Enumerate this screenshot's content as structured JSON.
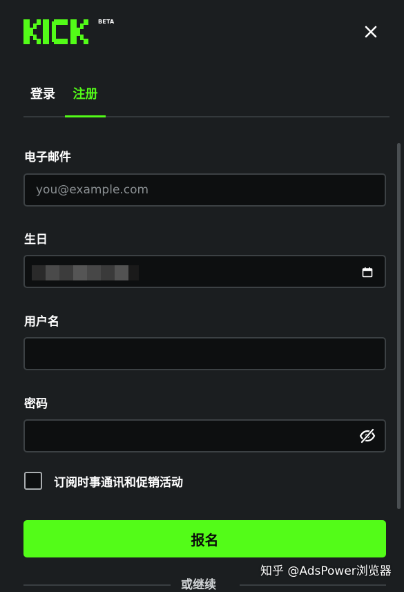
{
  "header": {
    "logo_text": "KICK",
    "badge": "BETA",
    "brand_color": "#53fc18",
    "close_icon": "close-icon"
  },
  "tabs": [
    {
      "label": "登录",
      "active": false
    },
    {
      "label": "注册",
      "active": true
    }
  ],
  "form": {
    "email": {
      "label": "电子邮件",
      "placeholder": "you@example.com",
      "value": ""
    },
    "birthday": {
      "label": "生日",
      "value_obscured": true,
      "icon": "calendar-icon"
    },
    "username": {
      "label": "用户名",
      "value": ""
    },
    "password": {
      "label": "密码",
      "value": "",
      "icon": "eye-off-icon"
    },
    "newsletter": {
      "label": "订阅时事通讯和促销活动",
      "checked": false
    },
    "submit_label": "报名",
    "divider_text": "或继续"
  },
  "watermark": "知乎 @AdsPower浏览器"
}
